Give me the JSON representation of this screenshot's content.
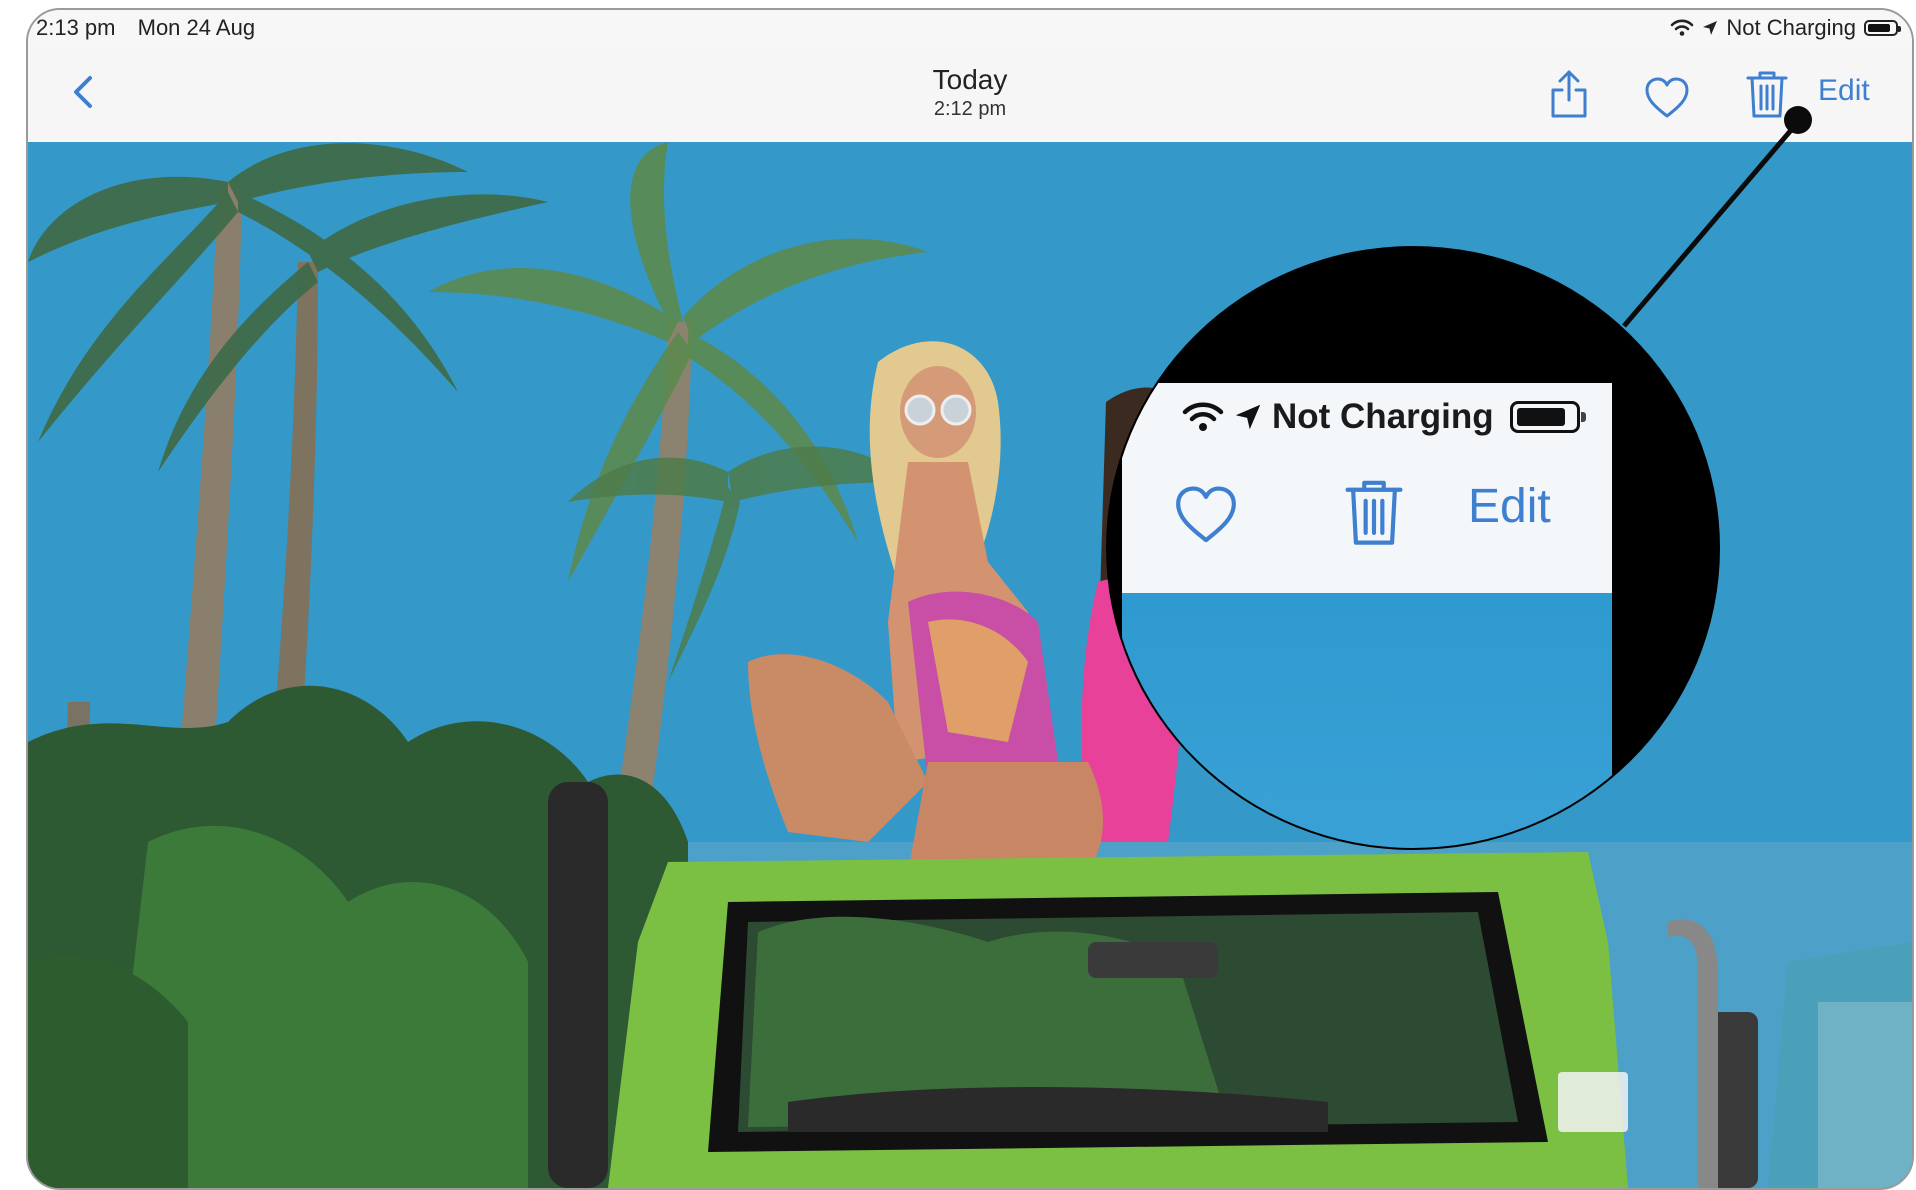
{
  "status_bar": {
    "time": "2:13 pm",
    "date": "Mon 24 Aug",
    "charging_status": "Not Charging",
    "icons": [
      "wifi-icon",
      "location-arrow-icon",
      "battery-icon"
    ]
  },
  "nav_bar": {
    "title": "Today",
    "subtitle": "2:12 pm",
    "edit_label": "Edit",
    "icons": [
      "chevron-left-icon",
      "share-icon",
      "heart-icon",
      "trash-icon"
    ],
    "accent_color": "#3f7fd0"
  },
  "photo": {
    "description_icon": "photo-image"
  },
  "callout": {
    "charging_status": "Not Charging",
    "edit_label": "Edit",
    "icons": [
      "wifi-icon",
      "location-arrow-icon",
      "battery-icon",
      "heart-icon",
      "trash-icon"
    ]
  }
}
